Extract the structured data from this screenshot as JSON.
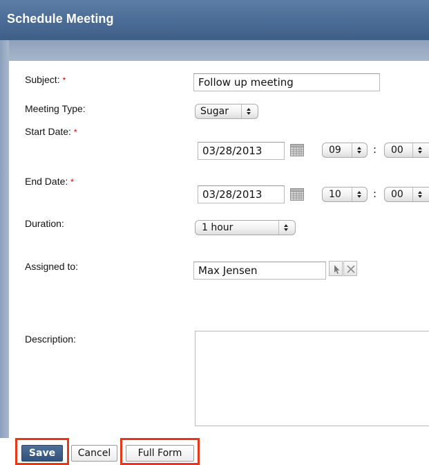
{
  "dialog": {
    "title": "Schedule Meeting"
  },
  "form": {
    "subject": {
      "label": "Subject:",
      "required": "*",
      "value": "Follow up meeting"
    },
    "meeting_type": {
      "label": "Meeting Type:",
      "value": "Sugar"
    },
    "start_date": {
      "label": "Start Date:",
      "required": "*",
      "date": "03/28/2013",
      "hour": "09",
      "minute": "00",
      "separator": ":"
    },
    "end_date": {
      "label": "End Date:",
      "required": "*",
      "date": "03/28/2013",
      "hour": "10",
      "minute": "00",
      "separator": ":"
    },
    "duration": {
      "label": "Duration:",
      "value": "1 hour"
    },
    "assigned_to": {
      "label": "Assigned to:",
      "value": "Max Jensen"
    },
    "description": {
      "label": "Description:",
      "value": ""
    }
  },
  "buttons": {
    "save": "Save",
    "cancel": "Cancel",
    "full_form": "Full Form"
  },
  "colors": {
    "header_bg": "#4a6b95",
    "primary_button": "#3d5d87",
    "highlight": "#e8361b",
    "required": "#d40000"
  },
  "icons": {
    "calendar": "calendar-icon",
    "select": "cursor-arrow-icon",
    "clear": "close-icon",
    "stepper": "up-down-arrows-icon"
  }
}
